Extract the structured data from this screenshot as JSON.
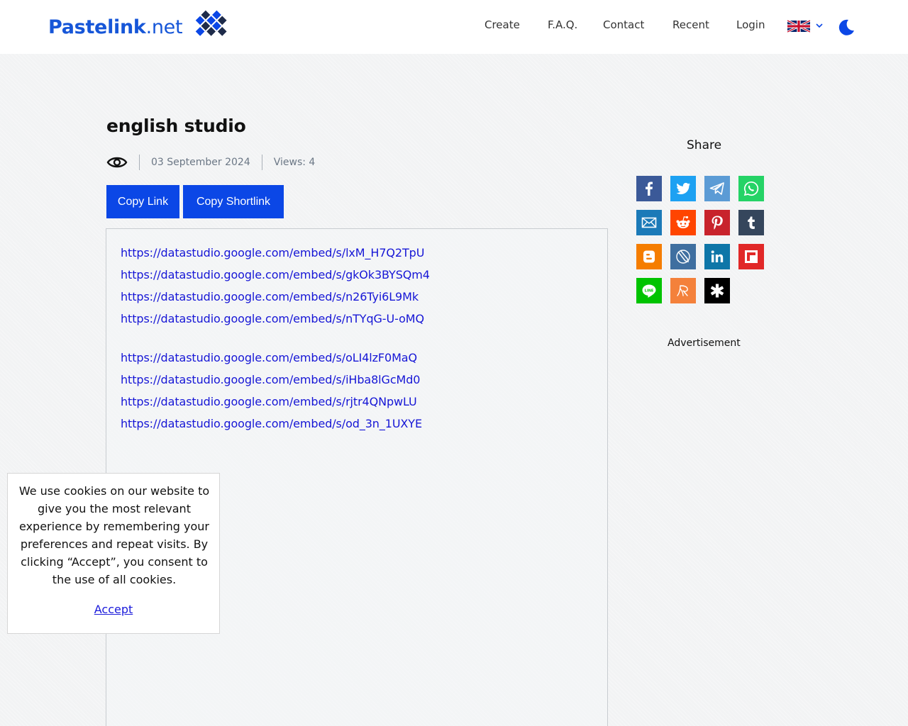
{
  "header": {
    "logo_bold": "Pastelink",
    "logo_light": ".net",
    "nav": [
      "Create",
      "F.A.Q.",
      "Contact",
      "Recent",
      "Login"
    ],
    "language_icon": "uk-flag-icon",
    "theme_icon": "moon-icon"
  },
  "paste": {
    "title": "english studio",
    "date": "03 September 2024",
    "views": "Views: 4",
    "copy_link": "Copy Link",
    "copy_shortlink": "Copy Shortlink",
    "links_group1": [
      "https://datastudio.google.com/embed/s/lxM_H7Q2TpU",
      "https://datastudio.google.com/embed/s/gkOk3BYSQm4",
      "https://datastudio.google.com/embed/s/n26Tyi6L9Mk",
      "https://datastudio.google.com/embed/s/nTYqG-U-oMQ"
    ],
    "links_group2": [
      "https://datastudio.google.com/embed/s/oLI4lzF0MaQ",
      "https://datastudio.google.com/embed/s/iHba8lGcMd0",
      "https://datastudio.google.com/embed/s/rjtr4QNpwLU",
      "https://datastudio.google.com/embed/s/od_3n_1UXYE"
    ]
  },
  "sidebar": {
    "share_title": "Share",
    "share_buttons": [
      {
        "name": "facebook",
        "color": "#3b5998"
      },
      {
        "name": "twitter",
        "color": "#1da1f2"
      },
      {
        "name": "telegram",
        "color": "#5b9bd5"
      },
      {
        "name": "whatsapp",
        "color": "#25d366"
      },
      {
        "name": "email",
        "color": "#1b7ab8"
      },
      {
        "name": "reddit",
        "color": "#ff4500"
      },
      {
        "name": "pinterest",
        "color": "#c8232c"
      },
      {
        "name": "tumblr",
        "color": "#35465c"
      },
      {
        "name": "blogger",
        "color": "#f57d00"
      },
      {
        "name": "livejournal",
        "color": "#3f6fa0"
      },
      {
        "name": "linkedin",
        "color": "#0e76a8"
      },
      {
        "name": "flipboard",
        "color": "#e12828"
      },
      {
        "name": "line",
        "color": "#00c300"
      },
      {
        "name": "renren",
        "color": "#f4813b"
      },
      {
        "name": "delicious",
        "color": "#000000"
      }
    ],
    "ad_label": "Advertisement"
  },
  "cookie": {
    "text": "We use cookies on our website to give you the most relevant experience by remembering your preferences and repeat visits. By clicking “Accept”, you consent to the use of all cookies.",
    "accept": "Accept"
  }
}
